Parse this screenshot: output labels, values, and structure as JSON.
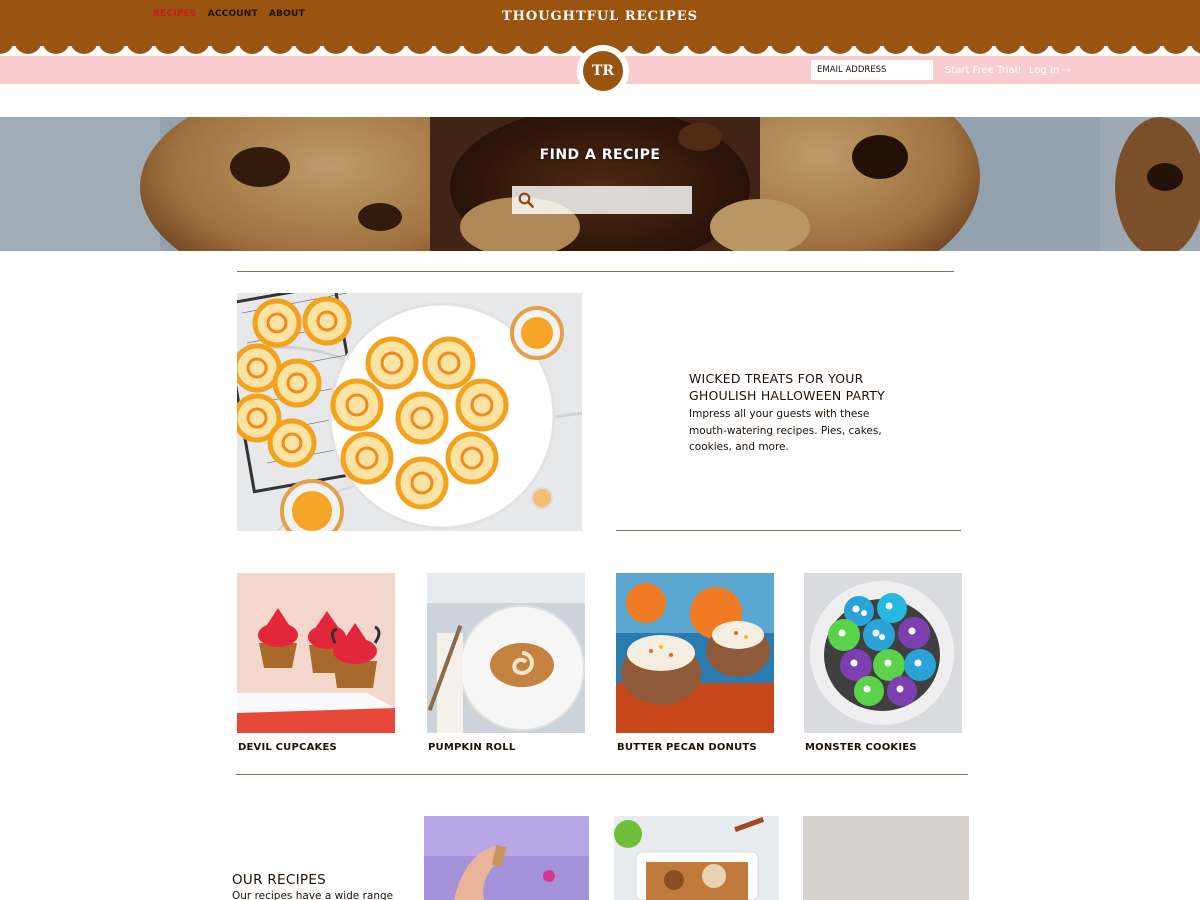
{
  "brand": {
    "site_title": "THOUGHTFUL RECIPES",
    "logo_text": "TR",
    "primary_color": "#9a5410",
    "nav_color": "#f9cdd0",
    "accent_color": "#d0181f"
  },
  "nav": {
    "links": [
      {
        "label": "RECIPES",
        "active": true
      },
      {
        "label": "ACCOUNT",
        "active": false
      },
      {
        "label": "ABOUT",
        "active": false
      }
    ],
    "email_placeholder": "EMAIL ADDRESS",
    "trial_label": "Start Free Trial!",
    "login_label": "Log in →"
  },
  "hero": {
    "title": "FIND A RECIPE",
    "search_icon": "search-icon",
    "image": "chocolate-chip-cookie-photo"
  },
  "feature": {
    "title": "WICKED TREATS FOR YOUR GHOULISH HALLOWEEN PARTY",
    "description": "Impress all your guests with these mouth-watering recipes. Pies, cakes, cookies, and more.",
    "image": "halloween-swirl-cookies-photo"
  },
  "cards": [
    {
      "label": "DEVIL CUPCAKES",
      "image": "devil-cupcakes-photo"
    },
    {
      "label": "PUMPKIN ROLL",
      "image": "pumpkin-roll-photo"
    },
    {
      "label": "BUTTER PECAN DONUTS",
      "image": "butter-pecan-donuts-photo"
    },
    {
      "label": "MONSTER COOKIES",
      "image": "monster-cookies-photo"
    }
  ],
  "our_recipes": {
    "title": "OUR RECIPES",
    "description": "Our recipes have a wide range"
  }
}
